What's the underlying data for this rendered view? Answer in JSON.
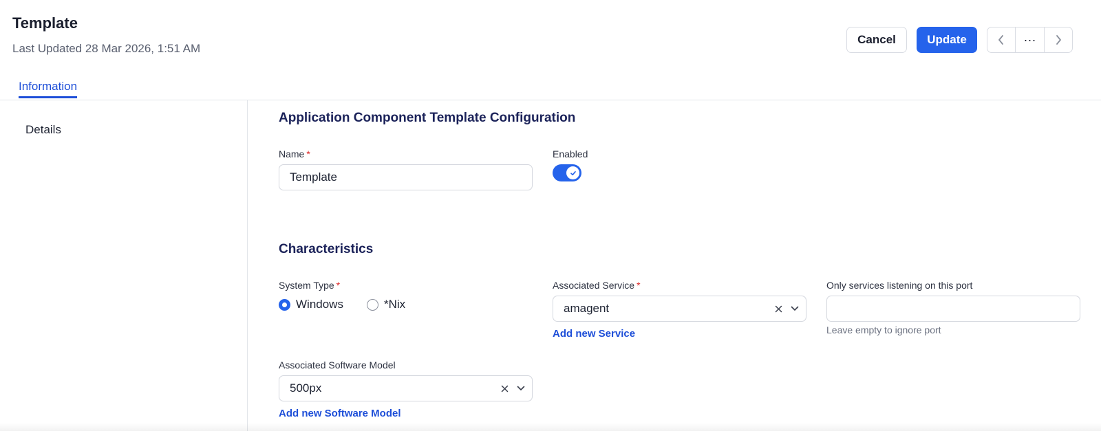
{
  "header": {
    "title": "Template",
    "subtitle": "Last Updated 28 Mar 2026, 1:51 AM",
    "cancel_label": "Cancel",
    "update_label": "Update",
    "more_label": "···"
  },
  "tabs": [
    {
      "label": "Information",
      "active": true
    }
  ],
  "sidebar": {
    "items": [
      {
        "label": "Details"
      }
    ]
  },
  "config": {
    "title": "Application Component Template Configuration",
    "name_label": "Name",
    "name_value": "Template",
    "enabled_label": "Enabled",
    "enabled": true
  },
  "characteristics": {
    "title": "Characteristics",
    "system_type_label": "System Type",
    "system_type_options": [
      {
        "label": "Windows",
        "selected": true
      },
      {
        "label": "*Nix",
        "selected": false
      }
    ],
    "associated_service_label": "Associated Service",
    "associated_service_value": "amagent",
    "add_service_link": "Add new Service",
    "port_label": "Only services listening on this port",
    "port_value": "",
    "port_hint": "Leave empty to ignore port",
    "software_model_label": "Associated Software Model",
    "software_model_value": "500px",
    "add_software_model_link": "Add new Software Model",
    "required_marker": "*"
  },
  "colors": {
    "accent": "#2563eb",
    "link": "#1d4ed8",
    "required": "#dc2626",
    "section_title": "#1b2259"
  },
  "icons": [
    "chevron-left-icon",
    "more-horizontal-icon",
    "chevron-right-icon",
    "check-icon",
    "close-icon",
    "chevron-down-icon"
  ]
}
